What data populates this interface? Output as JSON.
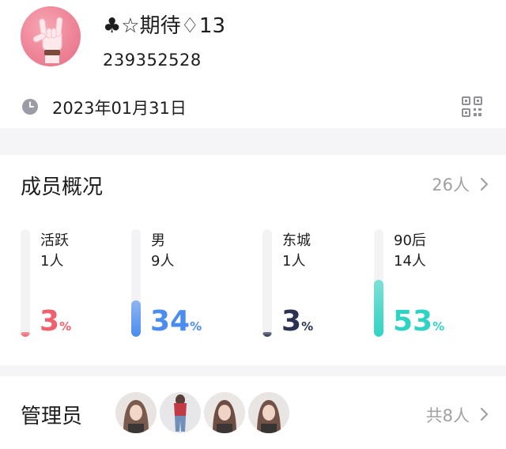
{
  "group": {
    "name": "♣☆期待♢13",
    "id": "239352528",
    "created_date": "2023年01月31日",
    "avatar_icon": "rock-hand-icon"
  },
  "members": {
    "title": "成员概况",
    "total": "26人",
    "stats": [
      {
        "label": "活跃",
        "count": "1人",
        "percent": 3,
        "unit": "%",
        "color": "#f0606f"
      },
      {
        "label": "男",
        "count": "9人",
        "percent": 34,
        "unit": "%",
        "color": "#4a8cf0"
      },
      {
        "label": "东城",
        "count": "1人",
        "percent": 3,
        "unit": "%",
        "color": "#2b3350"
      },
      {
        "label": "90后",
        "count": "14人",
        "percent": 53,
        "unit": "%",
        "color": "#2fd3c3"
      }
    ]
  },
  "admins": {
    "title": "管理员",
    "count": "共8人",
    "visible_avatars": 4
  },
  "icons": {
    "clock": "clock-icon",
    "qr": "qr-code-icon",
    "chevron": "chevron-right-icon"
  }
}
